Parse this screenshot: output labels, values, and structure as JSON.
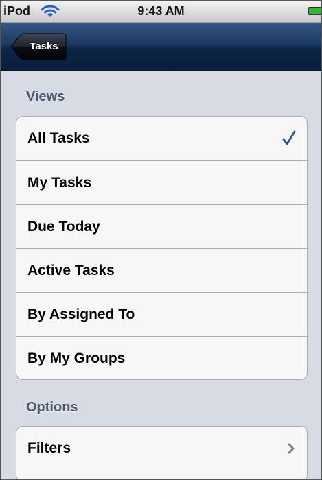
{
  "status_bar": {
    "carrier": "iPod",
    "time": "9:43 AM"
  },
  "nav_bar": {
    "back_label": "Tasks"
  },
  "views_section": {
    "header": "Views",
    "items": [
      {
        "label": "All Tasks",
        "selected": true
      },
      {
        "label": "My Tasks",
        "selected": false
      },
      {
        "label": "Due Today",
        "selected": false
      },
      {
        "label": "Active Tasks",
        "selected": false
      },
      {
        "label": "By Assigned To",
        "selected": false
      },
      {
        "label": "By My Groups",
        "selected": false
      }
    ]
  },
  "options_section": {
    "header": "Options",
    "items": [
      {
        "label": "Filters"
      }
    ]
  },
  "colors": {
    "checkmark": "#385487",
    "chevron": "#7f7f7f",
    "background": "#d7dbe3",
    "nav_bar": "#0c2446"
  },
  "icons": {
    "wifi": "wifi-icon",
    "battery": "battery-icon",
    "selected": "checkmark-icon",
    "disclosure": "chevron-right-icon"
  }
}
